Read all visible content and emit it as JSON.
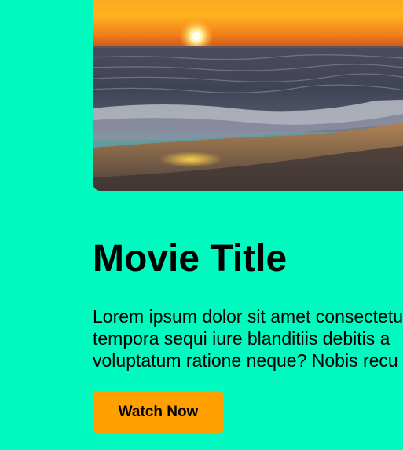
{
  "colors": {
    "background": "#00FABF",
    "button": "#FFA000",
    "text": "#000000"
  },
  "hero": {
    "image_semantic": "sunset-beach-poster"
  },
  "movie": {
    "title": "Movie Title",
    "description_lines": [
      "Lorem ipsum dolor sit amet consectetur",
      "tempora sequi iure blanditiis debitis a",
      "voluptatum ratione neque? Nobis recu"
    ],
    "watch_label": "Watch Now"
  }
}
